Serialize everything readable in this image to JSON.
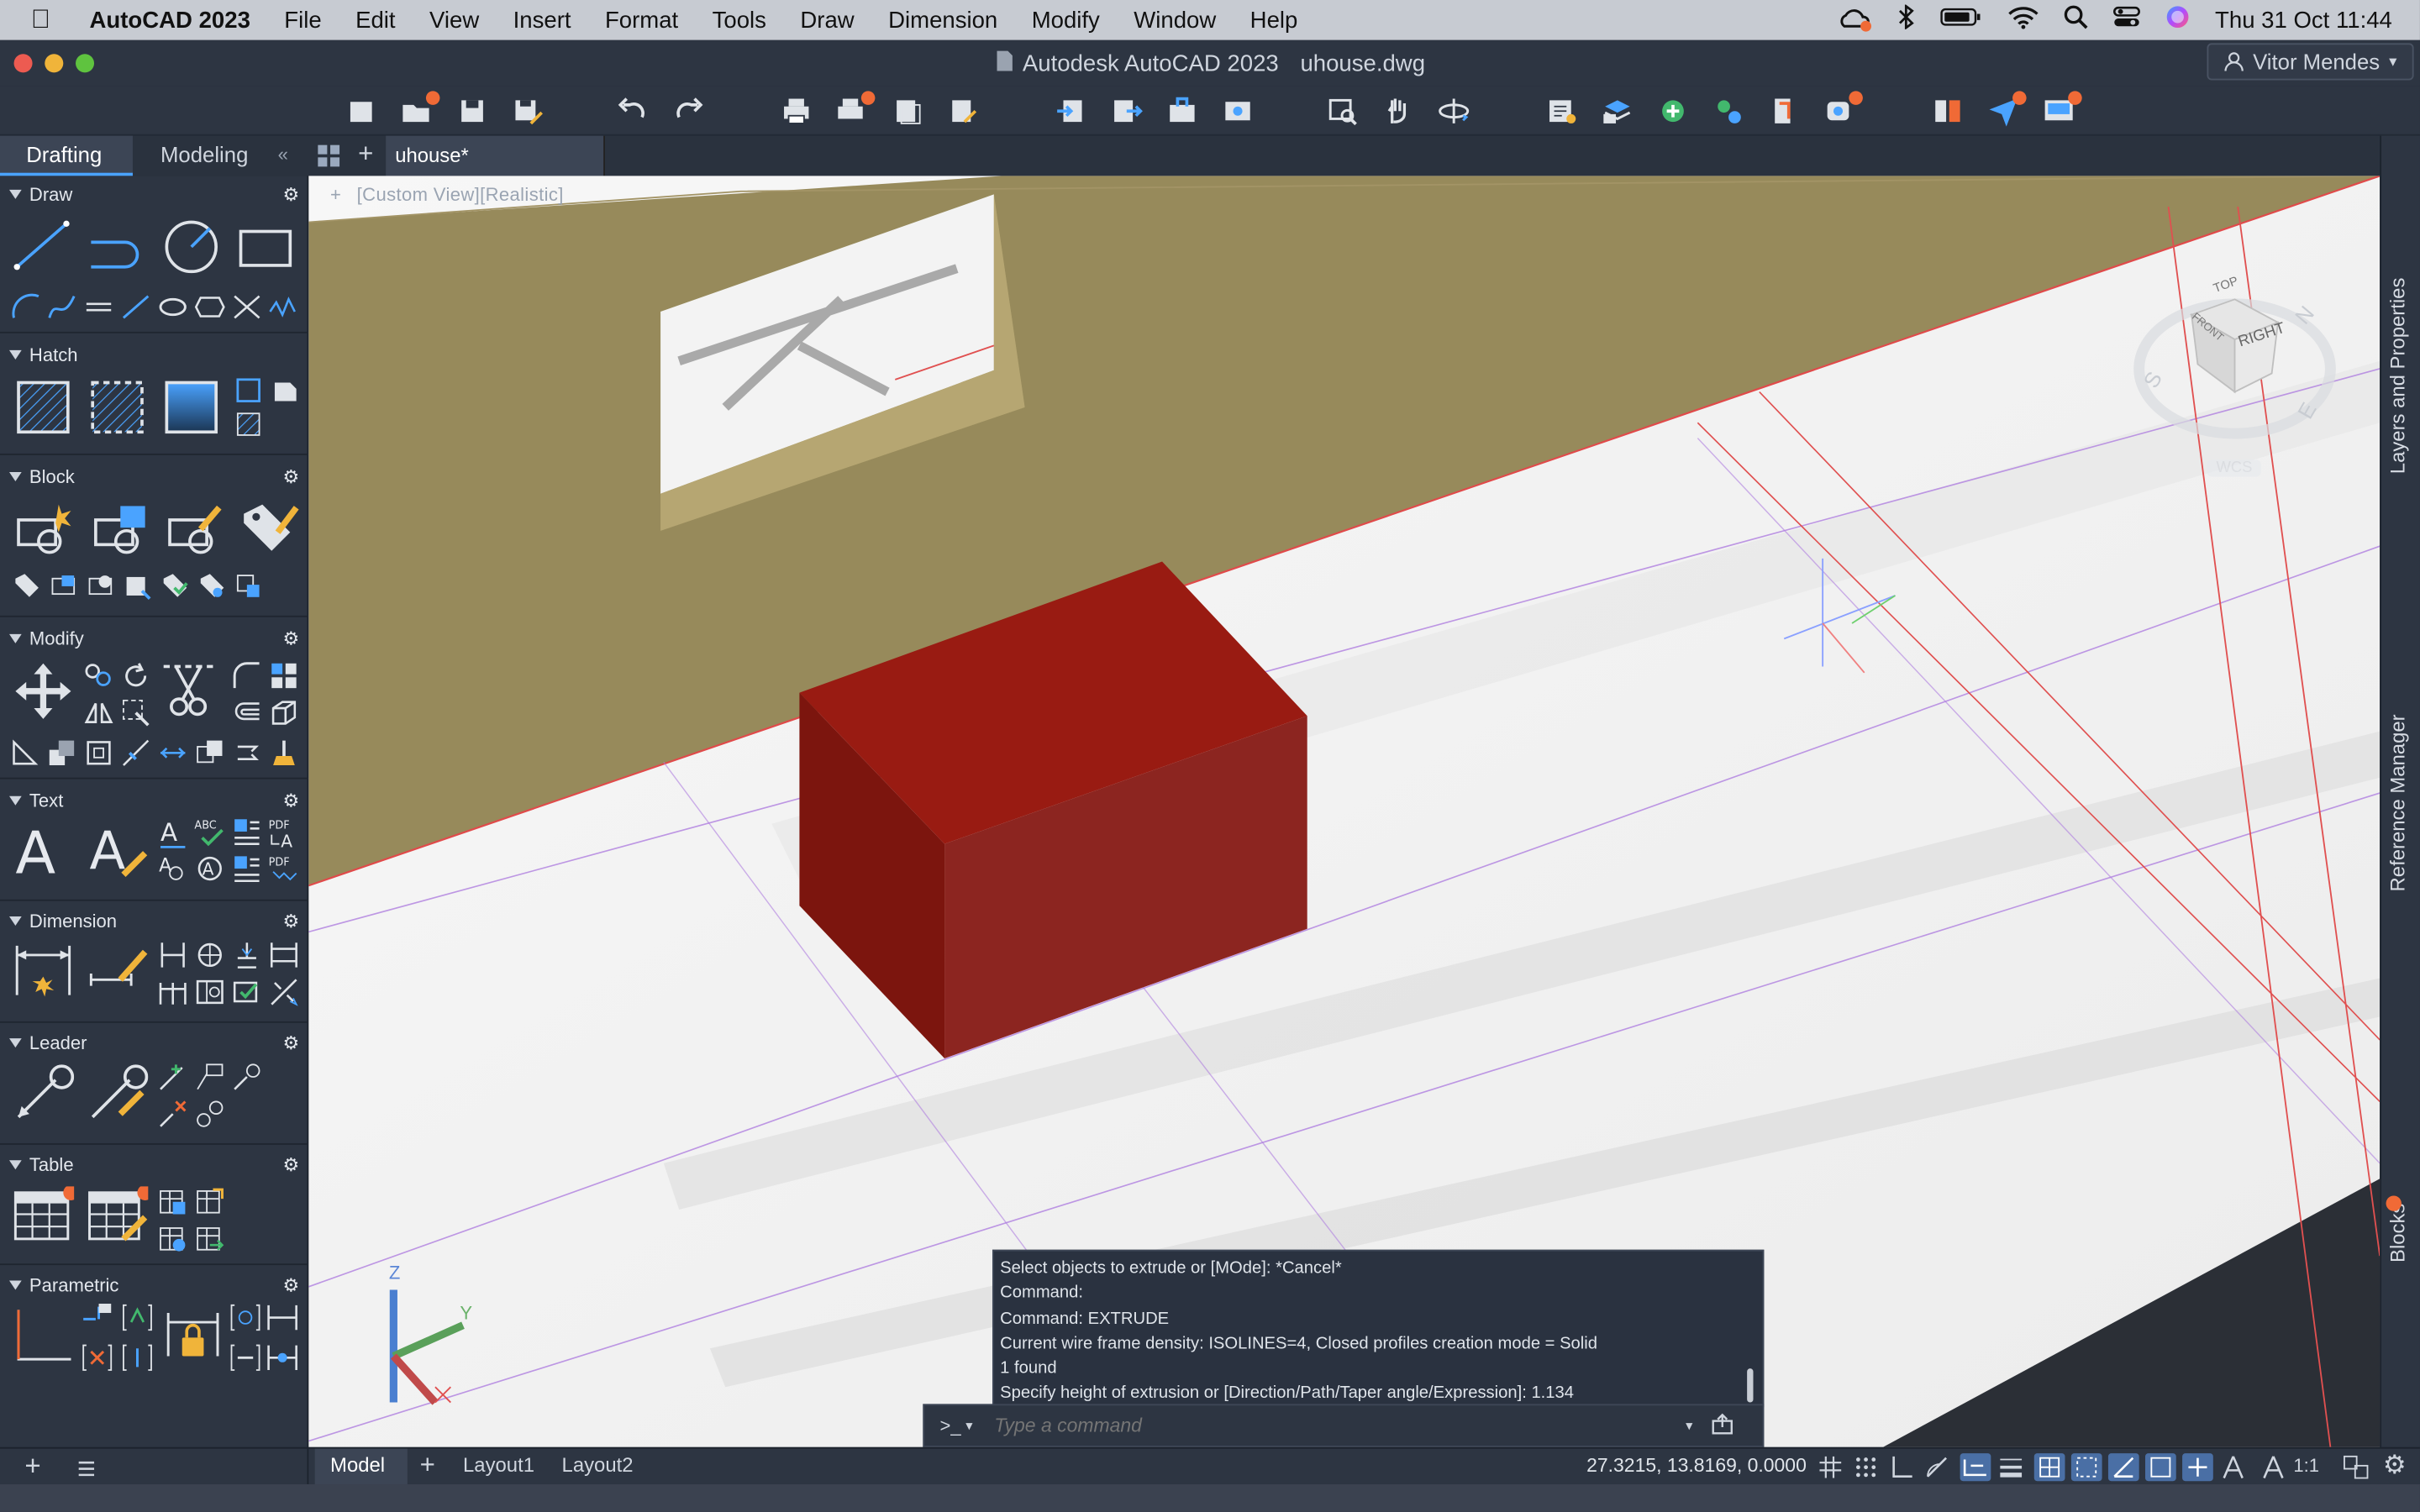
{
  "menubar": {
    "app_name": "AutoCAD 2023",
    "items": [
      "File",
      "Edit",
      "View",
      "Insert",
      "Format",
      "Tools",
      "Draw",
      "Dimension",
      "Modify",
      "Window",
      "Help"
    ],
    "clock": "Thu 31 Oct  11:44"
  },
  "window": {
    "title": "Autodesk AutoCAD 2023",
    "filename": "uhouse.dwg",
    "user": "Vitor Mendes"
  },
  "palette_tabs": {
    "drafting": "Drafting",
    "modeling": "Modeling"
  },
  "doc_tab": "uhouse*",
  "viewport_label": "[Custom View][Realistic]",
  "sections": {
    "draw": "Draw",
    "hatch": "Hatch",
    "block": "Block",
    "modify": "Modify",
    "text": "Text",
    "dimension": "Dimension",
    "leader": "Leader",
    "table": "Table",
    "parametric": "Parametric"
  },
  "right_panels": {
    "layers": "Layers and Properties",
    "reference": "Reference Manager",
    "blocks": "Blocks"
  },
  "viewcube": {
    "top": "TOP",
    "front": "FRONT",
    "right": "RIGHT",
    "n": "N",
    "s": "S",
    "e": "E",
    "wcs": "WCS"
  },
  "ucs": {
    "z": "Z",
    "y": "Y"
  },
  "command": {
    "history": [
      "Select objects to extrude or [MOde]: *Cancel*",
      "Command:",
      "Command: EXTRUDE",
      "Current wire frame density:  ISOLINES=4, Closed profiles creation mode = Solid",
      "1 found",
      "Specify height of extrusion or [Direction/Path/Taper angle/Expression]: 1.134"
    ],
    "prompt_symbol": ">_",
    "placeholder": "Type a command"
  },
  "status": {
    "model_tab": "Model",
    "layout1": "Layout1",
    "layout2": "Layout2",
    "coords": "27.3215, 13.8169, 0.0000",
    "scale": "1:1"
  },
  "colors": {
    "accent": "#f06a36",
    "solid_top": "#991b12",
    "wall": "#978a5b",
    "ui_bg": "#2d3542"
  }
}
